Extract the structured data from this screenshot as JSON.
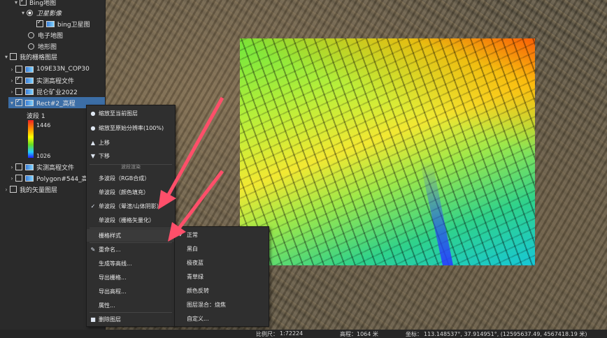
{
  "tree": {
    "rows": [
      {
        "label": "Bing地图",
        "level": 1
      },
      {
        "label": "卫星影像",
        "level": 2
      },
      {
        "label": "bing卫星图",
        "level": 3
      },
      {
        "label": "电子地图",
        "level": 2
      },
      {
        "label": "地形图",
        "level": 2
      },
      {
        "label": "我的栅格图层",
        "level": 0
      },
      {
        "label": "109E33N_COP30",
        "level": 1
      },
      {
        "label": "实测高程文件",
        "level": 1
      },
      {
        "label": "昆仑矿业2022",
        "level": 1
      },
      {
        "label": "Rect#2_高程",
        "level": 1
      },
      {
        "label": "实测高程文件",
        "level": 1
      },
      {
        "label": "Polygon#544_高程",
        "level": 1
      },
      {
        "label": "我的矢量图层",
        "level": 0
      }
    ],
    "legend": {
      "title": "波段 1",
      "max": "1446",
      "min": "1026"
    }
  },
  "context_menu": {
    "items": [
      {
        "label": "缩放至当前图层",
        "icon": "zoom-layer-icon"
      },
      {
        "label": "缩放至原始分辨率(100%)",
        "icon": "zoom-native-icon"
      },
      {
        "label": "上移",
        "icon": "move-up-icon"
      },
      {
        "label": "下移",
        "icon": "move-down-icon"
      }
    ],
    "section_band_render": "波段渲染",
    "render_items": [
      {
        "label": "多波段（RGB合成）",
        "checked": false
      },
      {
        "label": "单波段（颜色填充）",
        "checked": false
      },
      {
        "label": "单波段（晕渲/山体阴影）",
        "checked": true
      },
      {
        "label": "单波段（栅格矢量化）",
        "checked": false
      }
    ],
    "raster_style": "栅格样式",
    "rename": "重命名...",
    "more_items": [
      "生成等高线...",
      "导出栅格...",
      "导出高程...",
      "属性..."
    ],
    "delete": "删除图层"
  },
  "submenu": {
    "items": [
      {
        "label": "正常",
        "checked": true
      },
      {
        "label": "黑白",
        "checked": false
      },
      {
        "label": "极夜蓝",
        "checked": false
      },
      {
        "label": "青草绿",
        "checked": false
      },
      {
        "label": "颜色反转",
        "checked": false
      },
      {
        "label": "图层混合：烧焦",
        "checked": false
      },
      {
        "label": "自定义...",
        "checked": false
      }
    ]
  },
  "status_bar": {
    "scale_label": "比例尺：",
    "scale_value": "1:72224",
    "elev_label": "高程：",
    "elev_value": "1064 米",
    "coord_label": "坐标：",
    "coord_value": "113.148537°, 37.914951°, (12595637.49, 4567418.19 米)"
  },
  "colors": {
    "accent": "#3c6ea6",
    "arrow": "#ff4f6a"
  }
}
